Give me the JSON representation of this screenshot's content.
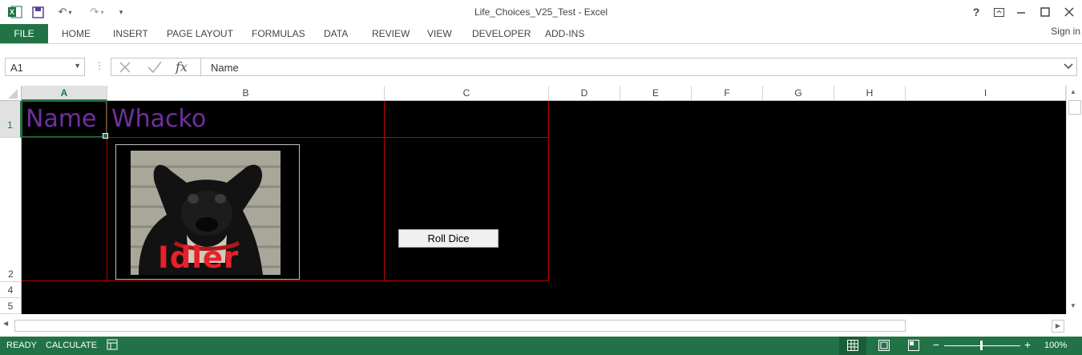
{
  "titlebar": {
    "title": "Life_Choices_V25_Test - Excel",
    "help": "?",
    "app_icon": "excel-logo-icon",
    "save_icon": "save-icon",
    "undo_icon": "undo-icon",
    "redo_icon": "redo-icon",
    "customize_icon": "customize-qat-icon"
  },
  "ribbon": {
    "file": "FILE",
    "tabs": [
      "HOME",
      "INSERT",
      "PAGE LAYOUT",
      "FORMULAS",
      "DATA",
      "REVIEW",
      "VIEW",
      "DEVELOPER",
      "ADD-INS"
    ],
    "sign_in": "Sign in"
  },
  "formula_bar": {
    "name_box": "A1",
    "content": "Name",
    "fx": "fx"
  },
  "grid": {
    "columns": [
      "A",
      "B",
      "C",
      "D",
      "E",
      "F",
      "G",
      "H",
      "I"
    ],
    "rows": [
      "1",
      "2",
      "4",
      "5"
    ],
    "cell_a1": "Name",
    "cell_b1": "Whacko",
    "image_caption": "Idler",
    "button_label": "Roll Dice",
    "selected_column": "A",
    "selected_row": "1"
  },
  "statusbar": {
    "ready": "READY",
    "calculate": "CALCULATE",
    "zoom": "100%"
  },
  "colors": {
    "accent": "#217346",
    "text_purple": "#7030a0",
    "border_red": "#c00000",
    "caption_red": "#e8202a",
    "sheet_bg": "#000000"
  }
}
